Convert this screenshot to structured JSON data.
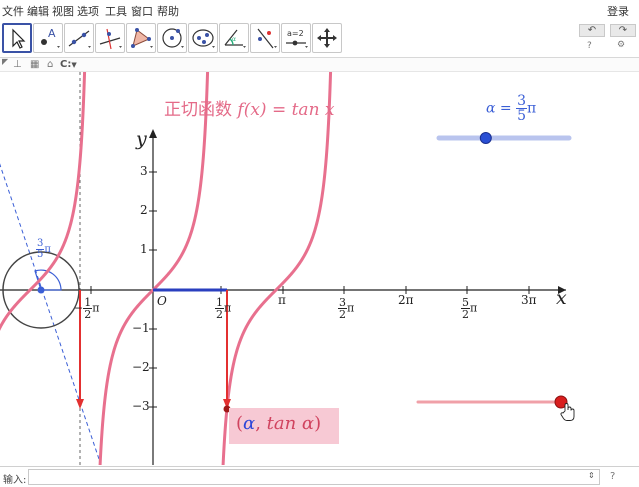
{
  "menu": {
    "items": [
      "文件",
      "编辑",
      "视图",
      "选项",
      "工具",
      "窗口",
      "帮助"
    ],
    "login": "登录"
  },
  "toolbar": {
    "tools": [
      {
        "name": "move-tool",
        "active": true
      },
      {
        "name": "point-tool",
        "active": false
      },
      {
        "name": "line-tool",
        "active": false
      },
      {
        "name": "perpendicular-tool",
        "active": false
      },
      {
        "name": "polygon-tool",
        "active": false
      },
      {
        "name": "circle-tool",
        "active": false
      },
      {
        "name": "ellipse-tool",
        "active": false
      },
      {
        "name": "angle-tool",
        "active": false
      },
      {
        "name": "reflect-tool",
        "active": false
      },
      {
        "name": "slider-tool",
        "active": false,
        "label": "a=2"
      },
      {
        "name": "move-graphics-view-tool",
        "active": false
      }
    ],
    "undo": "↶",
    "redo": "↷",
    "help": "?",
    "settings": "⚙"
  },
  "stylebar": {
    "graphics_label": "C:"
  },
  "graphics": {
    "title_text": "正切函数",
    "title_formula": " f(x) = tan x",
    "slider_prefix": "α =",
    "slider_num": "3",
    "slider_den": "5",
    "slider_suffix": "π",
    "slider_value_fraction": 0.6,
    "circle_angle_num": "3",
    "circle_angle_den": "5",
    "circle_angle_suffix": "π",
    "y_axis_name": "y",
    "x_axis_name": "x",
    "origin_label": "O",
    "y_ticks": [
      "3",
      "2",
      "1",
      "−1",
      "−2",
      "−3"
    ],
    "x_tick_half_num": "1",
    "x_tick_half_den": "2",
    "x_tick_pi": "π",
    "x_tick_neg_half_sign": "−",
    "x_tick_3half_num": "3",
    "x_tick_3half_den": "2",
    "x_tick_2pi": "2π",
    "x_tick_5half_num": "5",
    "x_tick_5half_den": "2",
    "x_tick_3pi": "3π",
    "point_label_open": "(",
    "point_label_alpha": "α",
    "point_label_tan": "tan α",
    "point_label_close": ")",
    "point_label_comma": ", ",
    "colors": {
      "curve": "#e8708e",
      "point": "#cc1f1f",
      "arrow": "#e33030",
      "slider": "#3b5fd6",
      "label_bg": "#f7c9d4"
    }
  },
  "inputbar": {
    "label": "输入:",
    "value": "",
    "spin": "⇕",
    "help": "?"
  }
}
